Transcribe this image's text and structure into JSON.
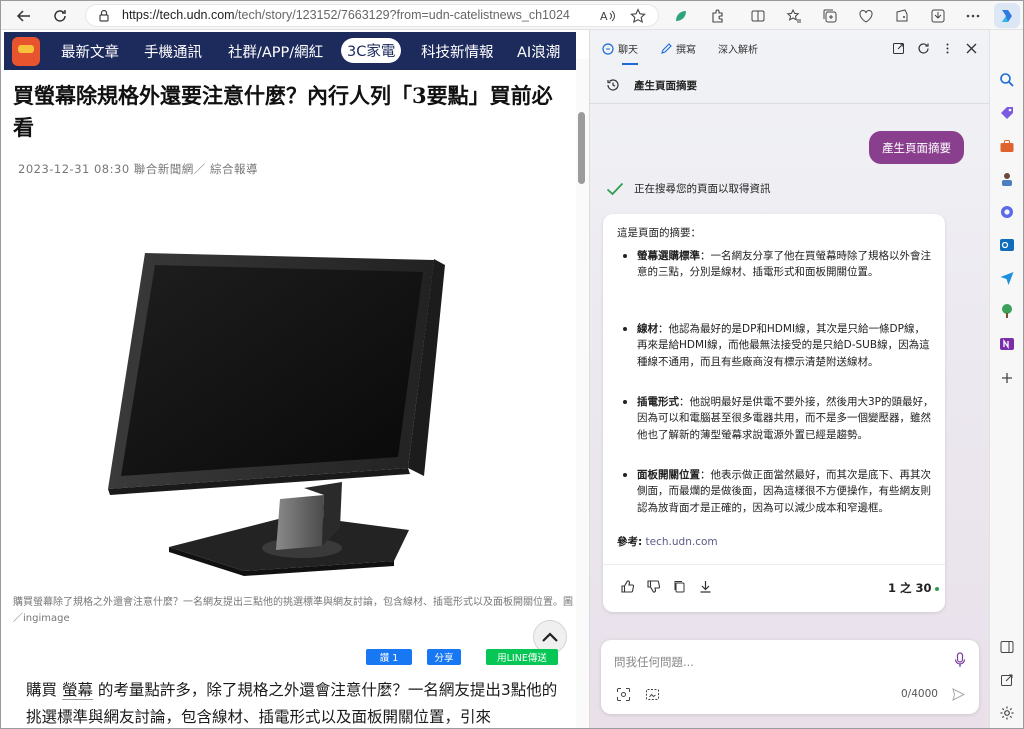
{
  "browser": {
    "url_host": "https://tech.udn.com",
    "url_path": "/tech/story/123152/7663129?from=udn-catelistnews_ch1024"
  },
  "site": {
    "categories": [
      "最新文章",
      "手機通訊",
      "社群/APP/網紅",
      "3C家電",
      "科技新情報",
      "AI浪潮"
    ],
    "active_category": "3C家電"
  },
  "article": {
    "title": "買螢幕除規格外還要注意什麼？內行人列「3要點」買前必看",
    "meta": "2023-12-31 08:30 聯合新聞網／ 綜合報導",
    "caption": "購買螢幕除了規格之外還會注意什麼？一名網友提出三點他的挑選標準與網友討論，包含線材、插電形式以及面板開關位置。圖／ingimage",
    "share_like": "讚 1",
    "share_fb": "分享",
    "share_line": "用LINE傳送",
    "body_keyword": "螢幕",
    "body_before": "購買",
    "body_after": "的考量點許多，除了規格之外還會注意什麼？一名網友提出3點他的挑選標準與網友討論，包含線材、插電形式以及面板開關位置，引來"
  },
  "copilot": {
    "tabs": [
      "聊天",
      "撰寫",
      "深入解析"
    ],
    "conversation_title": "產生頁面摘要",
    "user_message": "產生頁面摘要",
    "status": "正在搜尋您的頁面以取得資訊",
    "summary_intro": "這是頁面的摘要：",
    "bullets": [
      {
        "head": "螢幕選購標準",
        "text": "：一名網友分享了他在買螢幕時除了規格以外會注意的三點，分別是線材、插電形式和面板開關位置。"
      },
      {
        "head": "線材",
        "text": "：他認為最好的是DP和HDMI線，其次是只給一條DP線，再來是給HDMI線，而他最無法接受的是只給D-SUB線，因為這種線不通用，而且有些廠商沒有標示清楚附送線材。"
      },
      {
        "head": "插電形式",
        "text": "：他說明最好是供電不要外接，然後用大3P的頭最好，因為可以和電腦甚至很多電器共用，而不是多一個變壓器，雖然他也了解新的薄型螢幕求說電源外置已經是趨勢。"
      },
      {
        "head": "面板開關位置",
        "text": "：他表示做正面當然最好，而其次是底下、再其次側面，而最爛的是做後面，因為這樣很不方便操作，有些網友則認為放背面才是正確的，因為可以減少成本和窄邊框。"
      }
    ],
    "reference_label": "參考:",
    "reference_link": "tech.udn.com",
    "turn_counter": "1 之 30",
    "input_placeholder": "問我任何問題...",
    "char_count": "0/4000"
  },
  "colors": {
    "udn_nav": "#1c2a5c",
    "copilot_user_bubble": "#8a3f8e",
    "check_green": "#2e9e50",
    "accent_blue": "#1b6bd6"
  }
}
